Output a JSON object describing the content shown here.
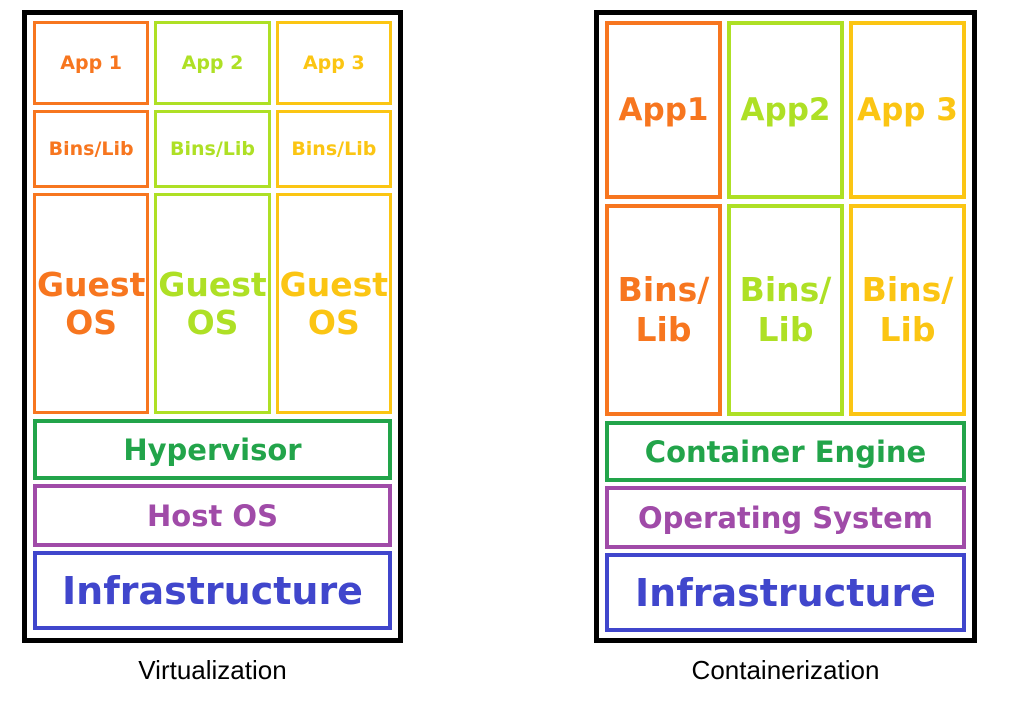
{
  "colors": {
    "orange": "#F7761F",
    "lime": "#AEE025",
    "amber": "#FBC513",
    "green": "#22A44A",
    "purple": "#A04BA8",
    "blue": "#4046CC",
    "frame": "#000000",
    "background": "#FFFFFF",
    "caption": "#000000"
  },
  "virtualization": {
    "caption": "Virtualization",
    "apps": [
      {
        "label": "App 1",
        "color": "#F7761F"
      },
      {
        "label": "App 2",
        "color": "#AEE025"
      },
      {
        "label": "App 3",
        "color": "#FBC513"
      }
    ],
    "bins": [
      {
        "label": "Bins/Lib",
        "color": "#F7761F"
      },
      {
        "label": "Bins/Lib",
        "color": "#AEE025"
      },
      {
        "label": "Bins/Lib",
        "color": "#FBC513"
      }
    ],
    "guest_os": [
      {
        "label": "Guest OS",
        "color": "#F7761F"
      },
      {
        "label": "Guest OS",
        "color": "#AEE025"
      },
      {
        "label": "Guest OS",
        "color": "#FBC513"
      }
    ],
    "platform": {
      "hypervisor": {
        "label": "Hypervisor",
        "color": "#22A44A"
      },
      "host_os": {
        "label": "Host OS",
        "color": "#A04BA8"
      },
      "infrastructure": {
        "label": "Infrastructure",
        "color": "#4046CC"
      }
    }
  },
  "containerization": {
    "caption": "Containerization",
    "apps": [
      {
        "label": "App1",
        "color": "#F7761F"
      },
      {
        "label": "App2",
        "color": "#AEE025"
      },
      {
        "label": "App 3",
        "color": "#FBC513"
      }
    ],
    "bins": [
      {
        "label": "Bins/ Lib",
        "color": "#F7761F"
      },
      {
        "label": "Bins/ Lib",
        "color": "#AEE025"
      },
      {
        "label": "Bins/ Lib",
        "color": "#FBC513"
      }
    ],
    "platform": {
      "container_engine": {
        "label": "Container Engine",
        "color": "#22A44A"
      },
      "operating_system": {
        "label": "Operating System",
        "color": "#A04BA8"
      },
      "infrastructure": {
        "label": "Infrastructure",
        "color": "#4046CC"
      }
    }
  }
}
